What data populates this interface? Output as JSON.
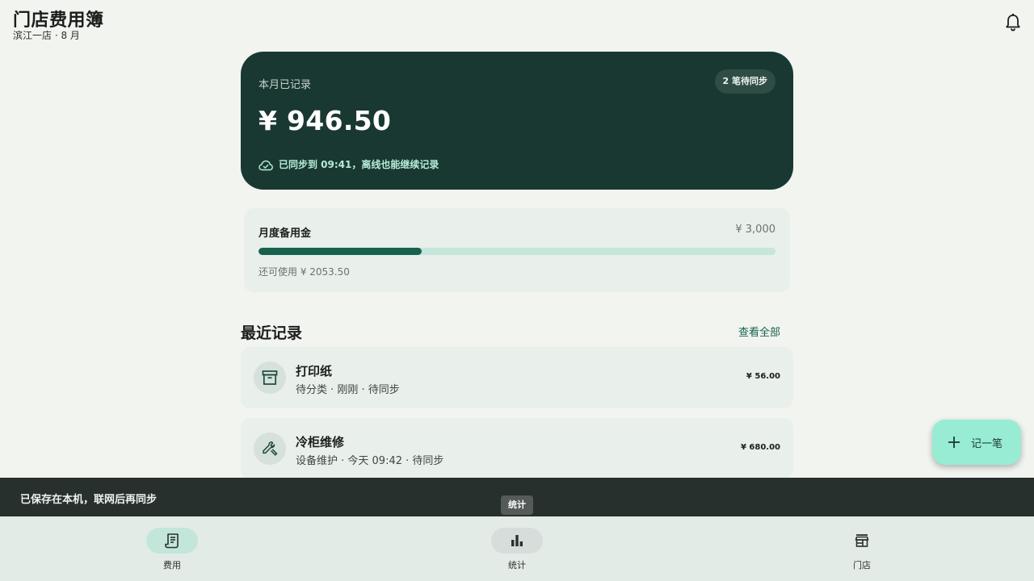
{
  "header": {
    "title": "门店费用簿",
    "subtitle": "滨江一店 · 8 月"
  },
  "summary": {
    "label": "本月已记录",
    "amount": "¥ 946.50",
    "pending_badge": "2 笔待同步",
    "sync_status": "已同步到 09:41，离线也能继续记录"
  },
  "budget": {
    "title": "月度备用金",
    "limit": "¥ 3,000",
    "used_fraction": 0.3155,
    "remaining": "还可使用 ¥ 2053.50"
  },
  "recent": {
    "title": "最近记录",
    "view_all": "查看全部",
    "items": [
      {
        "icon": "archive-box-icon",
        "title": "打印纸",
        "meta": "待分类 · 刚刚 · 待同步",
        "amount": "¥ 56.00"
      },
      {
        "icon": "wrench-icon",
        "title": "冷柜维修",
        "meta": "设备维护 · 今天 09:42 · 待同步",
        "amount": "¥ 680.00"
      }
    ]
  },
  "fab": {
    "label": "记一笔",
    "icon": "plus-icon"
  },
  "snackbar": {
    "text": "已保存在本机，联网后再同步"
  },
  "tooltip": {
    "text": "统计"
  },
  "nav": {
    "items": [
      {
        "label": "费用",
        "icon": "receipt-icon",
        "active": true
      },
      {
        "label": "统计",
        "icon": "bar-chart-icon",
        "active": false
      },
      {
        "label": "门店",
        "icon": "store-icon",
        "active": false
      }
    ]
  },
  "colors": {
    "background": "#f2f4ef",
    "summary_card": "#193832",
    "accent": "#17624f",
    "progress_track": "#c4e6db",
    "fab": "#98ecd4",
    "snackbar": "#27302d",
    "nav_active": "#c3e6da"
  }
}
